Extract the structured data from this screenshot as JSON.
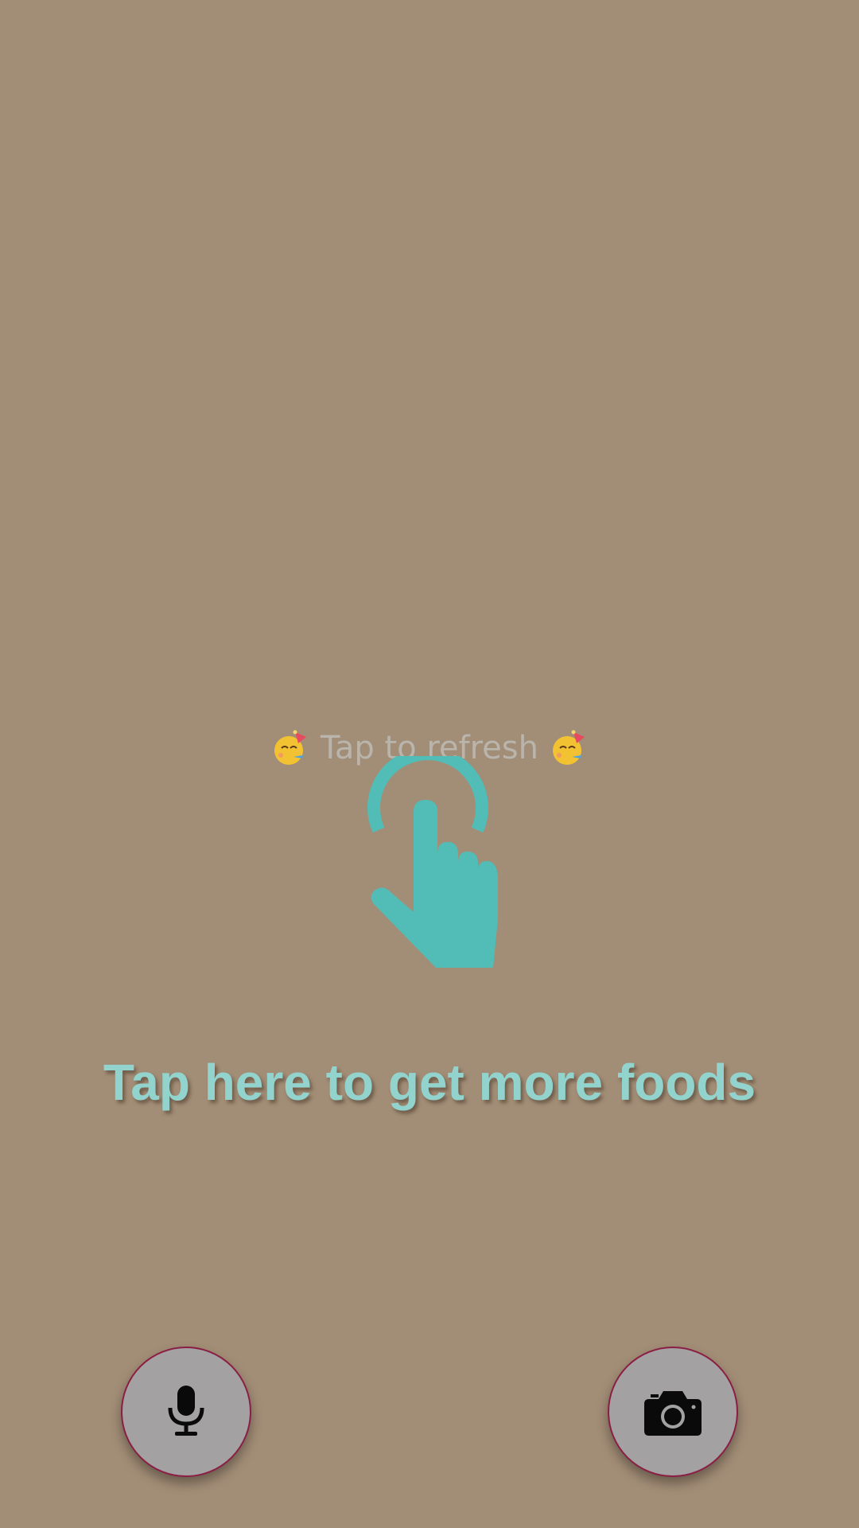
{
  "refresh": {
    "label": "Tap to refresh",
    "left_emoji": "partying-face-icon",
    "right_emoji": "partying-face-icon"
  },
  "hint": {
    "text": "Tap here to get more foods",
    "icon": "tap-gesture-icon",
    "color": "#52bcb6"
  },
  "actions": {
    "voice_icon": "microphone-icon",
    "camera_icon": "camera-icon"
  },
  "colors": {
    "background": "#a28d76",
    "fab_fill": "#a3a1a1",
    "fab_border": "#8a1e44"
  }
}
